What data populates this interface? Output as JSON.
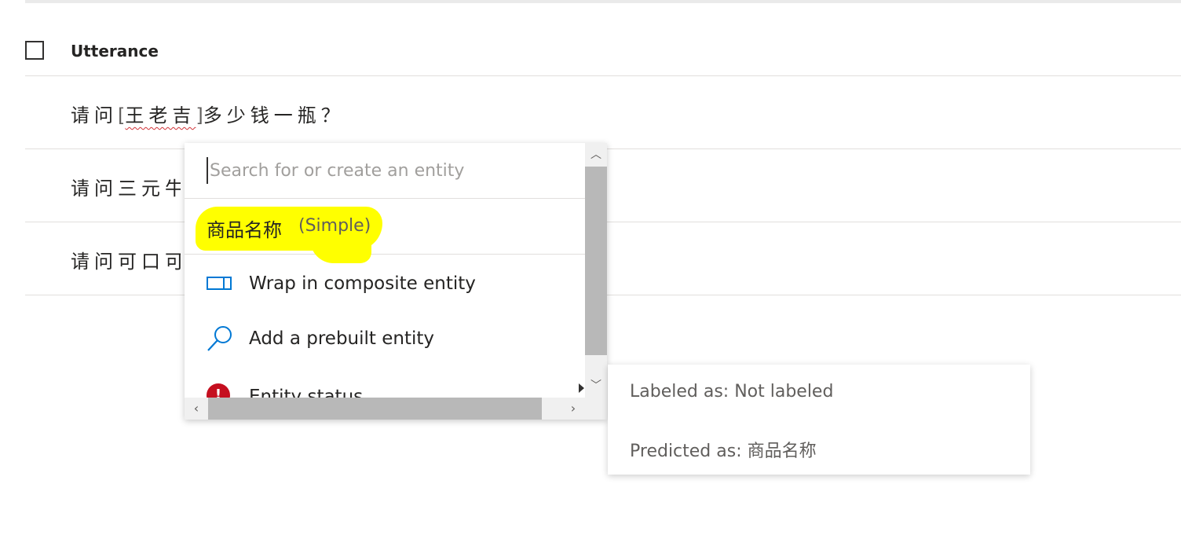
{
  "table": {
    "header_label": "Utterance"
  },
  "utterances": [
    {
      "prefix": "请问",
      "bracket_open": "[",
      "entity": "王老吉",
      "bracket_close": "]",
      "suffix": "多少钱一瓶？"
    },
    {
      "text": "请问三元牛"
    },
    {
      "text": "请问可口可"
    }
  ],
  "entity_picker": {
    "search_placeholder": "Search for or create an entity",
    "search_value": "",
    "option": {
      "name": "商品名称",
      "type": "(Simple)"
    },
    "menu": {
      "wrap_composite": "Wrap in composite entity",
      "add_prebuilt": "Add a prebuilt entity",
      "entity_status": "Entity status"
    },
    "status_icon_glyph": "!"
  },
  "status_panel": {
    "labeled_as": "Labeled as: Not labeled",
    "predicted_as": "Predicted as: 商品名称"
  },
  "colors": {
    "highlight": "#ffff00",
    "icon_blue": "#0078d4",
    "status_red": "#c50f1f",
    "scroll_thumb": "#b8b8b8"
  },
  "icons": {
    "wrap": "composite-box-icon",
    "prebuilt": "search-icon",
    "status": "error-icon"
  }
}
